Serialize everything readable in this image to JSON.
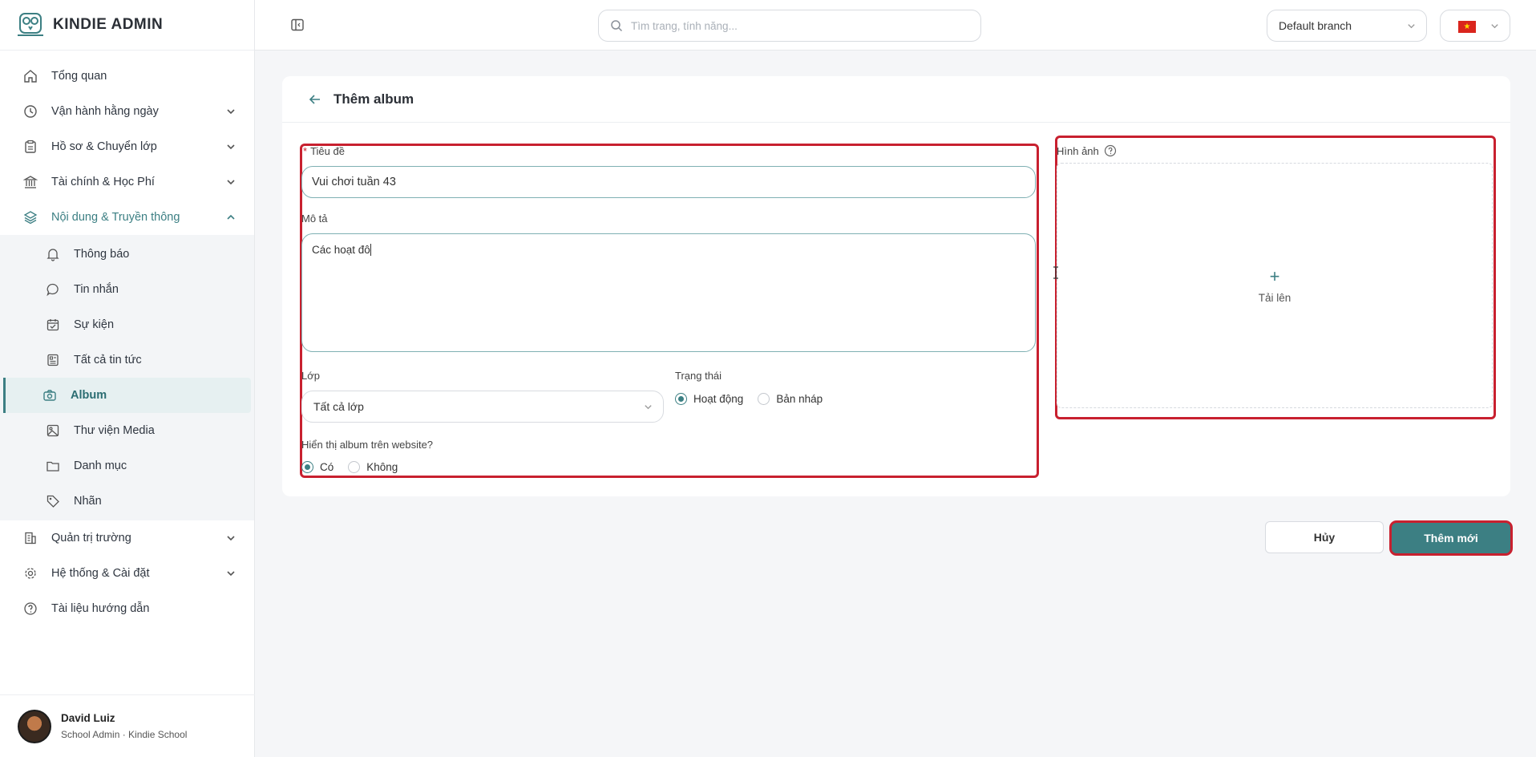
{
  "brand": {
    "name": "KINDIE ADMIN"
  },
  "nav": {
    "items": [
      {
        "label": "Tổng quan",
        "icon": "home-icon"
      },
      {
        "label": "Vận hành hằng ngày",
        "icon": "clock-icon"
      },
      {
        "label": "Hồ sơ & Chuyển lớp",
        "icon": "clipboard-icon"
      },
      {
        "label": "Tài chính & Học Phí",
        "icon": "bank-icon"
      },
      {
        "label": "Nội dung & Truyền thông",
        "icon": "layers-icon"
      }
    ],
    "sub_items": [
      {
        "label": "Thông báo",
        "icon": "bell-icon"
      },
      {
        "label": "Tin nhắn",
        "icon": "message-icon"
      },
      {
        "label": "Sự kiện",
        "icon": "calendar-check-icon"
      },
      {
        "label": "Tất cả tin tức",
        "icon": "newspaper-icon"
      },
      {
        "label": "Album",
        "icon": "camera-icon"
      },
      {
        "label": "Thư viện Media",
        "icon": "image-icon"
      },
      {
        "label": "Danh mục",
        "icon": "folder-icon"
      },
      {
        "label": "Nhãn",
        "icon": "tag-icon"
      }
    ],
    "bottom_items": [
      {
        "label": "Quản trị trường",
        "icon": "building-icon"
      },
      {
        "label": "Hệ thống & Cài đặt",
        "icon": "gear-icon"
      },
      {
        "label": "Tài liệu hướng dẫn",
        "icon": "help-circle-icon"
      }
    ]
  },
  "user": {
    "name": "David Luiz",
    "role": "School Admin · Kindie School"
  },
  "topbar": {
    "search_placeholder": "Tìm trang, tính năng...",
    "branch": "Default branch",
    "language_flag": "vietnam-flag-icon"
  },
  "page": {
    "title": "Thêm album"
  },
  "form": {
    "title_label": "Tiêu đề",
    "title_value": "Vui chơi tuần 43",
    "description_label": "Mô tả",
    "description_value": "Các hoạt đô",
    "class_label": "Lớp",
    "class_value": "Tất cả lớp",
    "status_label": "Trạng thái",
    "status_options": [
      "Hoạt động",
      "Bản nháp"
    ],
    "status_selected": "Hoạt động",
    "website_label": "Hiển thị album trên website?",
    "website_options": [
      "Có",
      "Không"
    ],
    "website_selected": "Có",
    "image_label": "Hình ảnh",
    "upload_label": "Tải lên"
  },
  "actions": {
    "cancel": "Hủy",
    "submit": "Thêm mới"
  },
  "colors": {
    "accent": "#3c7f83",
    "highlight": "#c8202f"
  }
}
